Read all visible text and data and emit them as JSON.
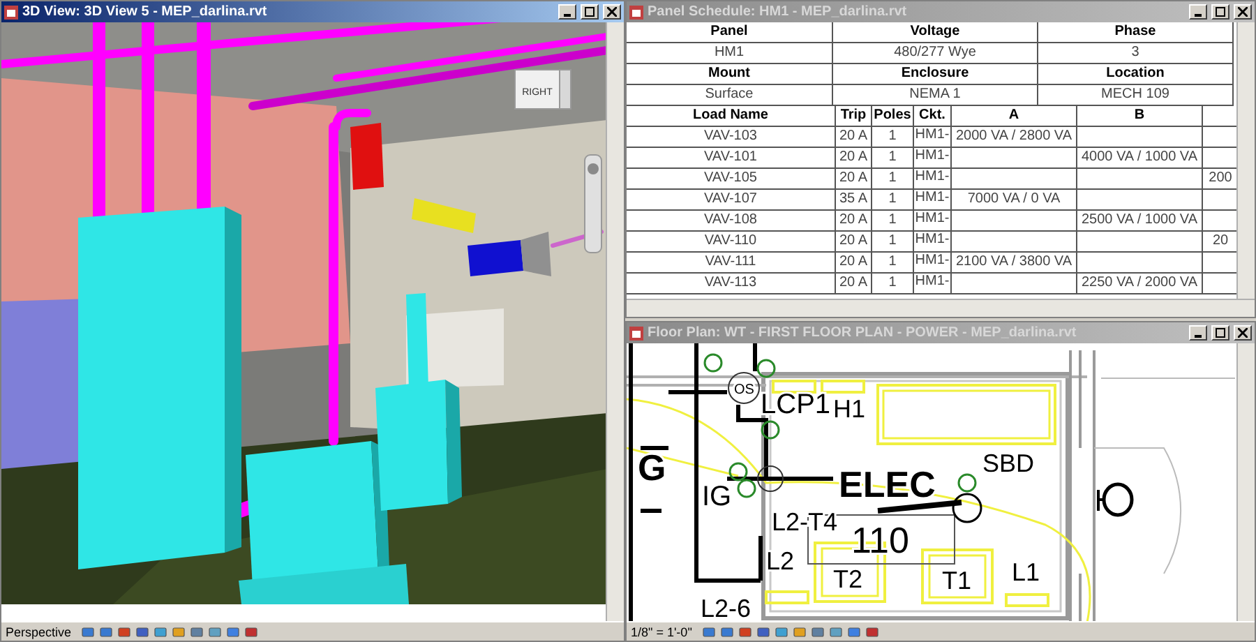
{
  "view_3d": {
    "title": "3D View: 3D View 5 - MEP_darlina.rvt",
    "active": true,
    "viewcube_label": "RIGHT",
    "status_text": "Perspective"
  },
  "panel_schedule": {
    "title": "Panel Schedule: HM1 - MEP_darlina.rvt",
    "active": false,
    "info": [
      [
        {
          "text": "Panel",
          "kind": "head"
        },
        {
          "text": "Voltage",
          "kind": "head"
        },
        {
          "text": "Phase",
          "kind": "head"
        }
      ],
      [
        {
          "text": "HM1",
          "kind": "value"
        },
        {
          "text": "480/277 Wye",
          "kind": "value"
        },
        {
          "text": "3",
          "kind": "value"
        }
      ],
      [
        {
          "text": "Mount",
          "kind": "head"
        },
        {
          "text": "Enclosure",
          "kind": "head"
        },
        {
          "text": "Location",
          "kind": "head"
        }
      ],
      [
        {
          "text": "Surface",
          "kind": "value"
        },
        {
          "text": "NEMA 1",
          "kind": "value"
        },
        {
          "text": "MECH 109",
          "kind": "value"
        }
      ]
    ],
    "columns": [
      "Load Name",
      "Trip",
      "Poles",
      "Ckt.",
      "A",
      "B",
      ""
    ],
    "rows": [
      [
        "VAV-103",
        "20 A",
        "1",
        "HM1-",
        "2000 VA / 2800 VA",
        "",
        ""
      ],
      [
        "VAV-101",
        "20 A",
        "1",
        "HM1-",
        "",
        "4000 VA / 1000 VA",
        ""
      ],
      [
        "VAV-105",
        "20 A",
        "1",
        "HM1-",
        "",
        "",
        "200"
      ],
      [
        "VAV-107",
        "35 A",
        "1",
        "HM1-",
        "7000 VA / 0 VA",
        "",
        ""
      ],
      [
        "VAV-108",
        "20 A",
        "1",
        "HM1-",
        "",
        "2500 VA / 1000 VA",
        ""
      ],
      [
        "VAV-110",
        "20 A",
        "1",
        "HM1-",
        "",
        "",
        "20"
      ],
      [
        "VAV-111",
        "20 A",
        "1",
        "HM1-",
        "2100 VA / 3800 VA",
        "",
        ""
      ],
      [
        "VAV-113",
        "20 A",
        "1",
        "HM1-",
        "",
        "2250 VA / 2000 VA",
        ""
      ]
    ]
  },
  "floor_plan": {
    "title": "Floor Plan: WT - FIRST FLOOR PLAN - POWER - MEP_darlina.rvt",
    "active": false,
    "scale": "1/8\" = 1'-0\"",
    "labels": [
      "OS",
      "LCP1",
      "H1",
      "SBD",
      "G",
      "IG",
      "ELEC",
      "L2-T4",
      "110",
      "L2",
      "T2",
      "T1",
      "L1",
      "L2-6"
    ]
  }
}
